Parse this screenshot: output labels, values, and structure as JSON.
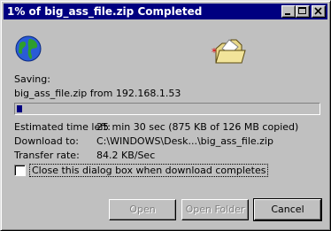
{
  "window": {
    "title": "1% of big_ass_file.zip Completed"
  },
  "dialog": {
    "saving_label": "Saving:",
    "saving_source": "big_ass_file.zip from 192.168.1.53",
    "progress_fraction": 0.01,
    "fields": [
      {
        "label": "Estimated time left:",
        "value": "25 min 30 sec (875 KB of 126 MB copied)"
      },
      {
        "label": "Download to:",
        "value": "C:\\WINDOWS\\Desk...\\big_ass_file.zip"
      },
      {
        "label": "Transfer rate:",
        "value": "84.2 KB/Sec"
      }
    ],
    "close_checkbox": {
      "label": "Close this dialog box when download completes",
      "checked": false
    },
    "buttons": {
      "open": "Open",
      "open_folder": "Open Folder",
      "cancel": "Cancel"
    }
  },
  "icons": {
    "globe": "globe-icon",
    "folder": "folder-icon"
  },
  "colors": {
    "titlebar": "#000080",
    "progress": "#000080"
  }
}
